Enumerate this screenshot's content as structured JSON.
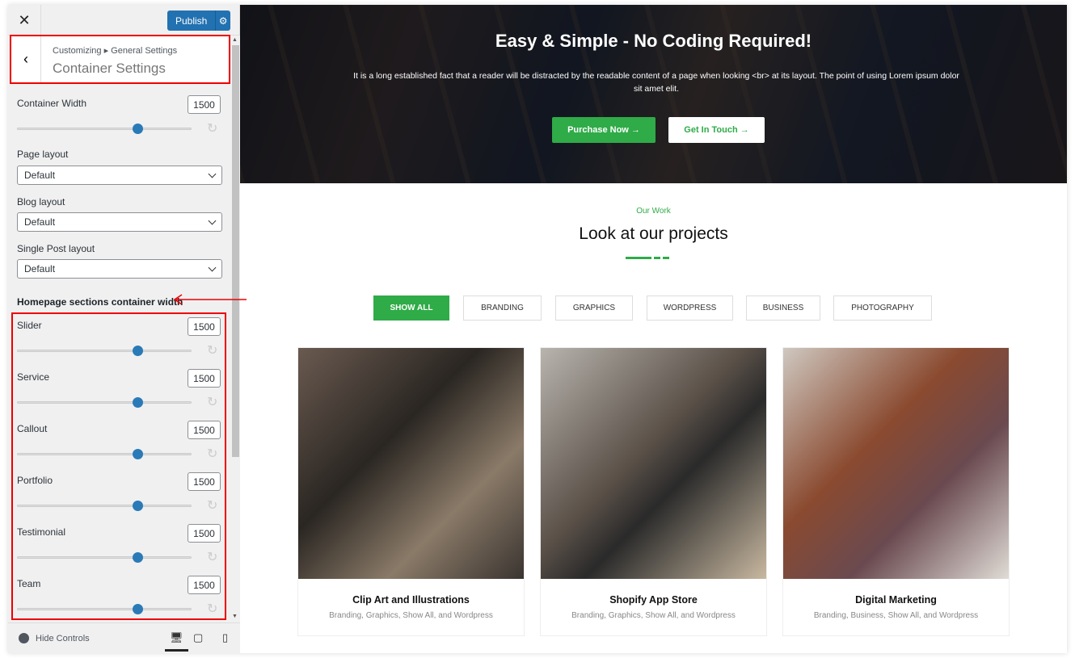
{
  "sidebar": {
    "close_icon": "close-icon",
    "publish_label": "Publish",
    "breadcrumb": "Customizing ▸ General Settings",
    "title": "Container Settings",
    "container_width": {
      "label": "Container Width",
      "value": "1500",
      "slider_fraction": 0.69
    },
    "selects": [
      {
        "label": "Page layout",
        "value": "Default"
      },
      {
        "label": "Blog layout",
        "value": "Default"
      },
      {
        "label": "Single Post layout",
        "value": "Default"
      }
    ],
    "section_heading": "Homepage sections container width",
    "sections": [
      {
        "label": "Slider",
        "value": "1500",
        "slider_fraction": 0.69
      },
      {
        "label": "Service",
        "value": "1500",
        "slider_fraction": 0.69
      },
      {
        "label": "Callout",
        "value": "1500",
        "slider_fraction": 0.69
      },
      {
        "label": "Portfolio",
        "value": "1500",
        "slider_fraction": 0.69
      },
      {
        "label": "Testimonial",
        "value": "1500",
        "slider_fraction": 0.69
      },
      {
        "label": "Team",
        "value": "1500",
        "slider_fraction": 0.69
      }
    ],
    "hide_controls": "Hide Controls"
  },
  "preview": {
    "hero": {
      "title": "Easy & Simple - No Coding Required!",
      "text": "It is a long established fact that a reader will be distracted by the readable content of a page when looking <br> at its layout. The point of using Lorem ipsum dolor sit amet elit.",
      "primary": "Purchase Now →",
      "secondary": "Get In Touch →"
    },
    "eyebrow": "Our Work",
    "heading": "Look at our projects",
    "filters": [
      "SHOW ALL",
      "BRANDING",
      "GRAPHICS",
      "WORDPRESS",
      "BUSINESS",
      "PHOTOGRAPHY"
    ],
    "cards": [
      {
        "title": "Clip Art and Illustrations",
        "tags": "Branding, Graphics, Show All, and Wordpress"
      },
      {
        "title": "Shopify App Store",
        "tags": "Branding, Graphics, Show All, and Wordpress"
      },
      {
        "title": "Digital Marketing",
        "tags": "Branding, Business, Show All, and Wordpress"
      }
    ]
  },
  "colors": {
    "accent": "#2fab48",
    "publish": "#2271b1",
    "highlight": "#ee0000"
  }
}
